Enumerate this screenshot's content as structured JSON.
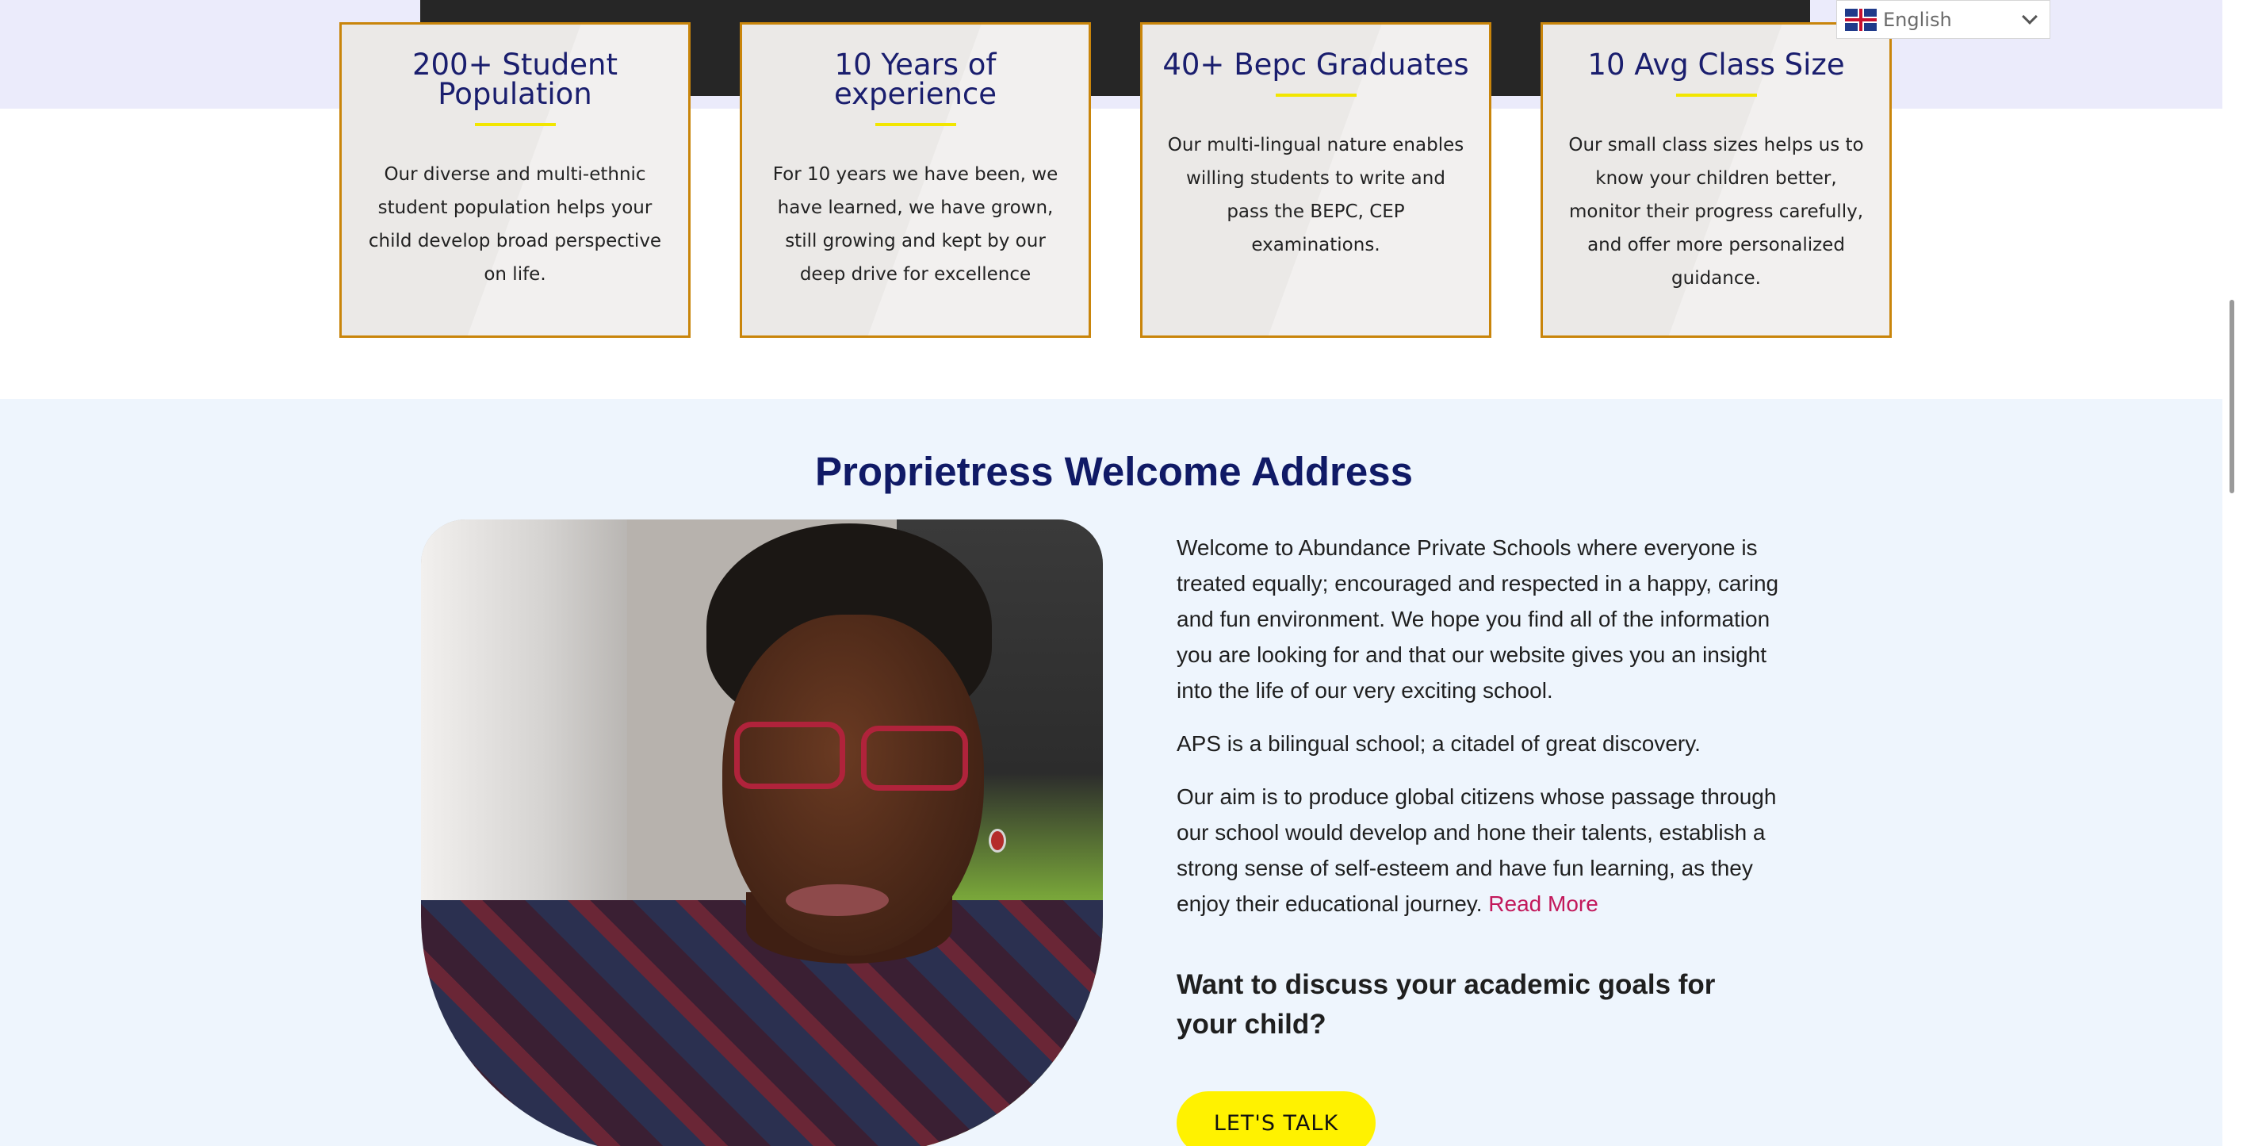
{
  "stats": [
    {
      "title": "200+ Student Population",
      "text": "Our diverse and multi-ethnic student population helps your child develop broad perspective on life."
    },
    {
      "title": "10 Years of experience",
      "text": "For 10 years we have been, we have learned, we have grown, still growing and kept by our deep drive for excellence"
    },
    {
      "title": "40+ Bepc Graduates",
      "text": "Our multi-lingual nature enables willing students to write and pass the BEPC, CEP examinations."
    },
    {
      "title": "10 Avg Class Size",
      "text": "Our small class sizes helps us to know your children better, monitor their progress carefully, and offer more personalized guidance."
    }
  ],
  "welcome": {
    "title": "Proprietress Welcome Address",
    "paragraph_1": "Welcome to Abundance Private Schools where everyone is treated equally; encouraged and respected in a happy, caring and fun environment. We hope you find all of the information you are looking for and that our website gives you an insight into the life of our very exciting school.",
    "paragraph_2": "APS is a bilingual school; a citadel of great discovery.",
    "paragraph_3": "Our aim is to produce global citizens whose passage through our school would develop and hone their talents, establish a strong sense of self-esteem and have fun learning, as they enjoy their educational journey.",
    "read_more": "Read More",
    "cta_heading": "Want to discuss your academic goals for your child?",
    "cta_button": "LET'S TALK"
  },
  "language": {
    "selected": "English"
  },
  "colors": {
    "accent_yellow": "#fff200",
    "title_navy": "#101a66",
    "card_border": "#c9850b",
    "link_pink": "#c2185b"
  },
  "icons": [
    "uk-flag-icon",
    "chevron-down-icon"
  ]
}
